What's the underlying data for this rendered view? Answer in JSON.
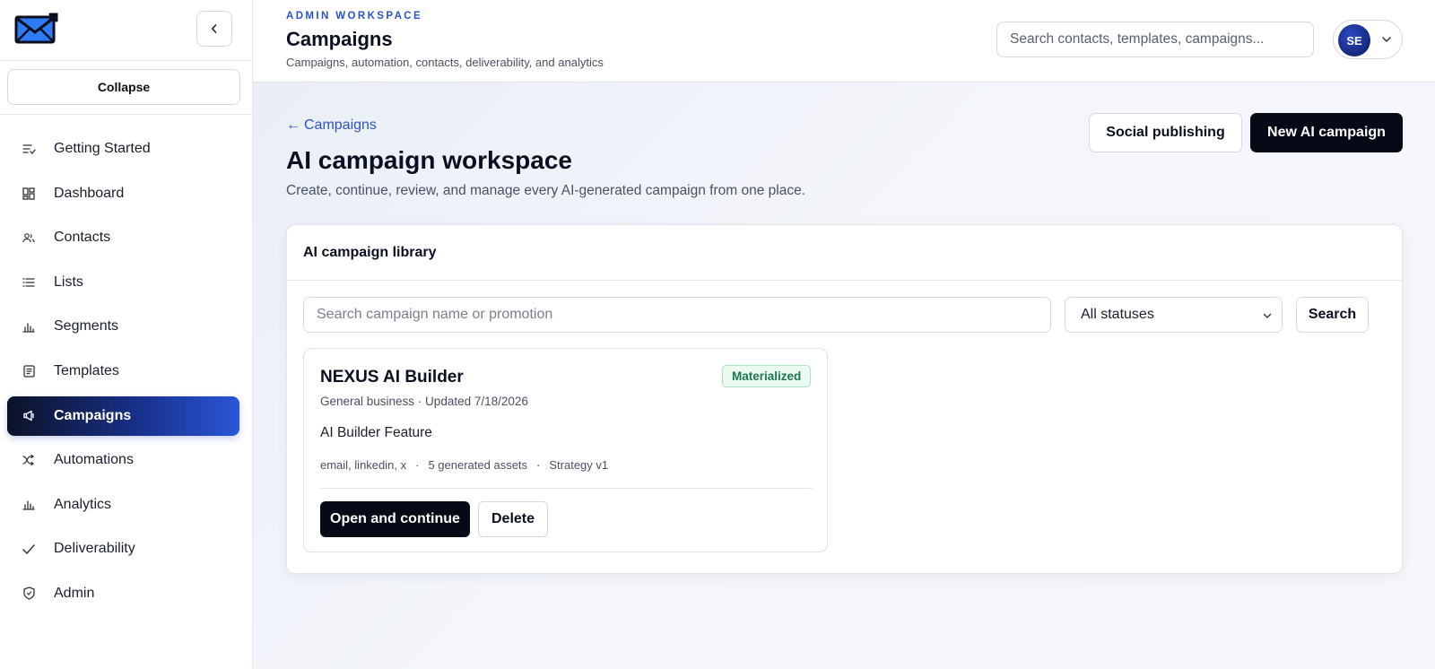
{
  "sidebar": {
    "logo_icon": "mail-envelope-icon",
    "collapse_label": "Collapse",
    "items": [
      {
        "label": "Getting Started",
        "icon": "checklist-icon"
      },
      {
        "label": "Dashboard",
        "icon": "dashboard-grid-icon"
      },
      {
        "label": "Contacts",
        "icon": "contacts-icon"
      },
      {
        "label": "Lists",
        "icon": "list-icon"
      },
      {
        "label": "Segments",
        "icon": "bar-chart-icon"
      },
      {
        "label": "Templates",
        "icon": "document-icon"
      },
      {
        "label": "Campaigns",
        "icon": "megaphone-icon",
        "active": true
      },
      {
        "label": "Automations",
        "icon": "shuffle-icon"
      },
      {
        "label": "Analytics",
        "icon": "bar-chart-icon"
      },
      {
        "label": "Deliverability",
        "icon": "check-icon"
      },
      {
        "label": "Admin",
        "icon": "shield-icon"
      }
    ]
  },
  "header": {
    "eyebrow": "ADMIN WORKSPACE",
    "title": "Campaigns",
    "subtitle": "Campaigns, automation, contacts, deliverability, and analytics",
    "search_placeholder": "Search contacts, templates, campaigns...",
    "user_initials": "SE"
  },
  "main": {
    "back_link": "Campaigns",
    "title": "AI campaign workspace",
    "subtitle": "Create, continue, review, and manage every AI-generated campaign from one place.",
    "social_button": "Social publishing",
    "new_button": "New AI campaign",
    "library": {
      "title": "AI campaign library",
      "search_placeholder": "Search campaign name or promotion",
      "status_selected": "All statuses",
      "search_button": "Search",
      "cards": [
        {
          "title": "NEXUS AI Builder",
          "status": "Materialized",
          "meta": "General business · Updated 7/18/2026",
          "promotion": "AI Builder Feature",
          "channels": "email, linkedin, x",
          "assets": "5 generated assets",
          "strategy": "Strategy v1",
          "open_button": "Open and continue",
          "delete_button": "Delete"
        }
      ]
    }
  },
  "colors": {
    "accent": "#2a55c9",
    "active_nav_start": "#0b1228",
    "active_nav_end": "#2a56d8",
    "primary_button": "#060a17",
    "badge_text": "#1b7a4d",
    "badge_bg": "#ecfaf2"
  }
}
